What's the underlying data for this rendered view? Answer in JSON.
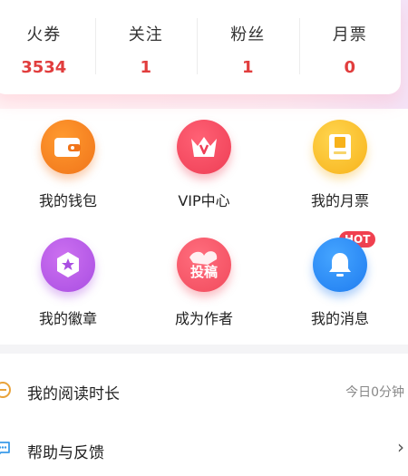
{
  "stats": [
    {
      "label": "火券",
      "value": "3534"
    },
    {
      "label": "关注",
      "value": "1"
    },
    {
      "label": "粉丝",
      "value": "1"
    },
    {
      "label": "月票",
      "value": "0"
    }
  ],
  "grid": [
    {
      "label": "我的钱包",
      "icon": "wallet-icon"
    },
    {
      "label": "VIP中心",
      "icon": "crown-icon"
    },
    {
      "label": "我的月票",
      "icon": "ticket-icon"
    },
    {
      "label": "我的徽章",
      "icon": "badge-icon"
    },
    {
      "label": "成为作者",
      "icon": "submission-icon",
      "icon_text": "投稿",
      "badge": "HOT"
    },
    {
      "label": "我的消息",
      "icon": "bell-icon"
    }
  ],
  "list": [
    {
      "label": "我的阅读时长",
      "value": "今日0分钟",
      "icon": "clock-icon"
    },
    {
      "label": "帮助与反馈",
      "icon": "chat-icon",
      "chevron": "›"
    }
  ],
  "colors": {
    "accent_red": "#e13d3d",
    "wallet": "#f0741a",
    "vip": "#ee3e55",
    "ticket": "#f7b21a",
    "badge": "#a94ee2",
    "author": "#f14a5c",
    "message": "#1f7cf0"
  }
}
